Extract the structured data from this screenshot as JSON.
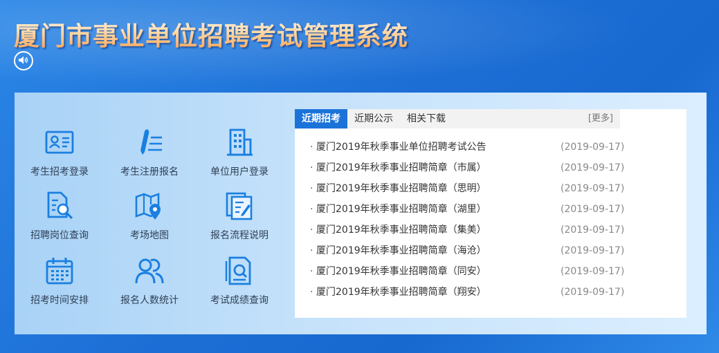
{
  "header": {
    "title": "厦门市事业单位招聘考试管理系统"
  },
  "menu": [
    {
      "label": "考生招考登录",
      "icon": "id-card-icon"
    },
    {
      "label": "考生注册报名",
      "icon": "pen-list-icon"
    },
    {
      "label": "单位用户登录",
      "icon": "building-icon"
    },
    {
      "label": "招聘岗位查询",
      "icon": "document-search-icon"
    },
    {
      "label": "考场地图",
      "icon": "map-pin-icon"
    },
    {
      "label": "报名流程说明",
      "icon": "clipboard-edit-icon"
    },
    {
      "label": "招考时间安排",
      "icon": "calendar-icon"
    },
    {
      "label": "报名人数统计",
      "icon": "users-icon"
    },
    {
      "label": "考试成绩查询",
      "icon": "score-search-icon"
    }
  ],
  "news": {
    "tabs": [
      "近期招考",
      "近期公示",
      "相关下载"
    ],
    "active_tab": "近期招考",
    "more_label": "[更多]",
    "bullet": "·",
    "items": [
      {
        "title": "厦门2019年秋季事业单位招聘考试公告",
        "date": "(2019-09-17)"
      },
      {
        "title": "厦门2019年秋季事业招聘简章（市属）",
        "date": "(2019-09-17)"
      },
      {
        "title": "厦门2019年秋季事业招聘简章（思明）",
        "date": "(2019-09-17)"
      },
      {
        "title": "厦门2019年秋季事业招聘简章（湖里）",
        "date": "(2019-09-17)"
      },
      {
        "title": "厦门2019年秋季事业招聘简章（集美）",
        "date": "(2019-09-17)"
      },
      {
        "title": "厦门2019年秋季事业招聘简章（海沧）",
        "date": "(2019-09-17)"
      },
      {
        "title": "厦门2019年秋季事业招聘简章（同安）",
        "date": "(2019-09-17)"
      },
      {
        "title": "厦门2019年秋季事业招聘简章（翔安）",
        "date": "(2019-09-17)"
      }
    ]
  },
  "colors": {
    "accent": "#1b73d9",
    "icon_blue": "#1a7fe0",
    "background": "#1d6fd6"
  }
}
